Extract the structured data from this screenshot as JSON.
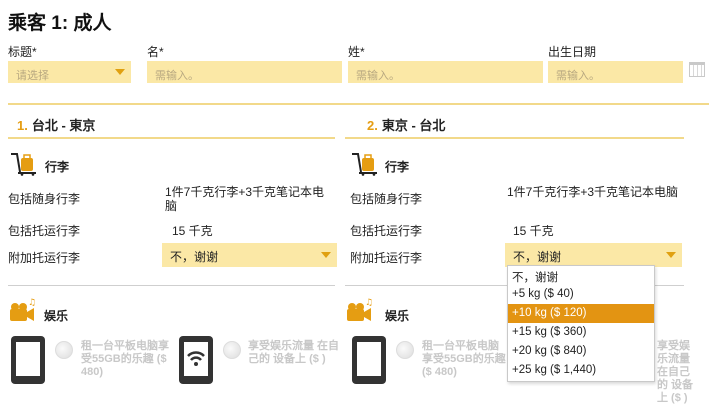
{
  "passenger_title": "乘客 1: 成人",
  "form": {
    "title_label": "标题*",
    "title_placeholder": "请选择",
    "first_label": "名*",
    "first_placeholder": "需输入。",
    "last_label": "姓*",
    "last_placeholder": "需输入。",
    "dob_label": "出生日期",
    "dob_placeholder": "需输入。"
  },
  "segments": [
    {
      "number": "1.",
      "route": "台北 - 東京",
      "baggage_title": "行李",
      "carry_on_label": "包括随身行李",
      "carry_on_value": "1件7千克行李+3千克笔记本电脑",
      "checked_label": "包括托运行李",
      "checked_value": "15 千克",
      "extra_label": "附加托运行李",
      "extra_value": "不，谢谢",
      "entertainment_title": "娱乐",
      "rent_text": "租一台平板电脑享受55GB的乐趣 ($ 480)",
      "stream_text": "享受娱乐流量 在自己的 设备上 ($ )"
    },
    {
      "number": "2.",
      "route": "東京 - 台北",
      "baggage_title": "行李",
      "carry_on_label": "包括随身行李",
      "carry_on_value": "1件7千克行李+3千克笔记本电脑",
      "checked_label": "包括托运行李",
      "checked_value": "15 千克",
      "extra_label": "附加托运行李",
      "extra_value": "不，谢谢",
      "entertainment_title": "娱乐",
      "rent_text": "租一台平板电脑享受55GB的乐趣 ($ 480)",
      "stream_text": "享受娱乐流量 在自己的 设备上 ($ )"
    }
  ],
  "dropdown_options": [
    "不，谢谢",
    "+5 kg ($ 40)",
    "+10 kg ($ 120)",
    "+15 kg ($ 360)",
    "+20 kg ($ 840)",
    "+25 kg ($ 1,440)"
  ],
  "selected_option_index": 2,
  "colors": {
    "field_bg": "#fbe8a6",
    "accent_orange": "#e59d12",
    "selected_option_bg": "#e39412"
  },
  "icons": {
    "luggage": "luggage-icon",
    "entertainment": "music-camera-icon",
    "tablet": "tablet-icon",
    "wifi": "wifi-icon",
    "calendar": "calendar-icon"
  }
}
